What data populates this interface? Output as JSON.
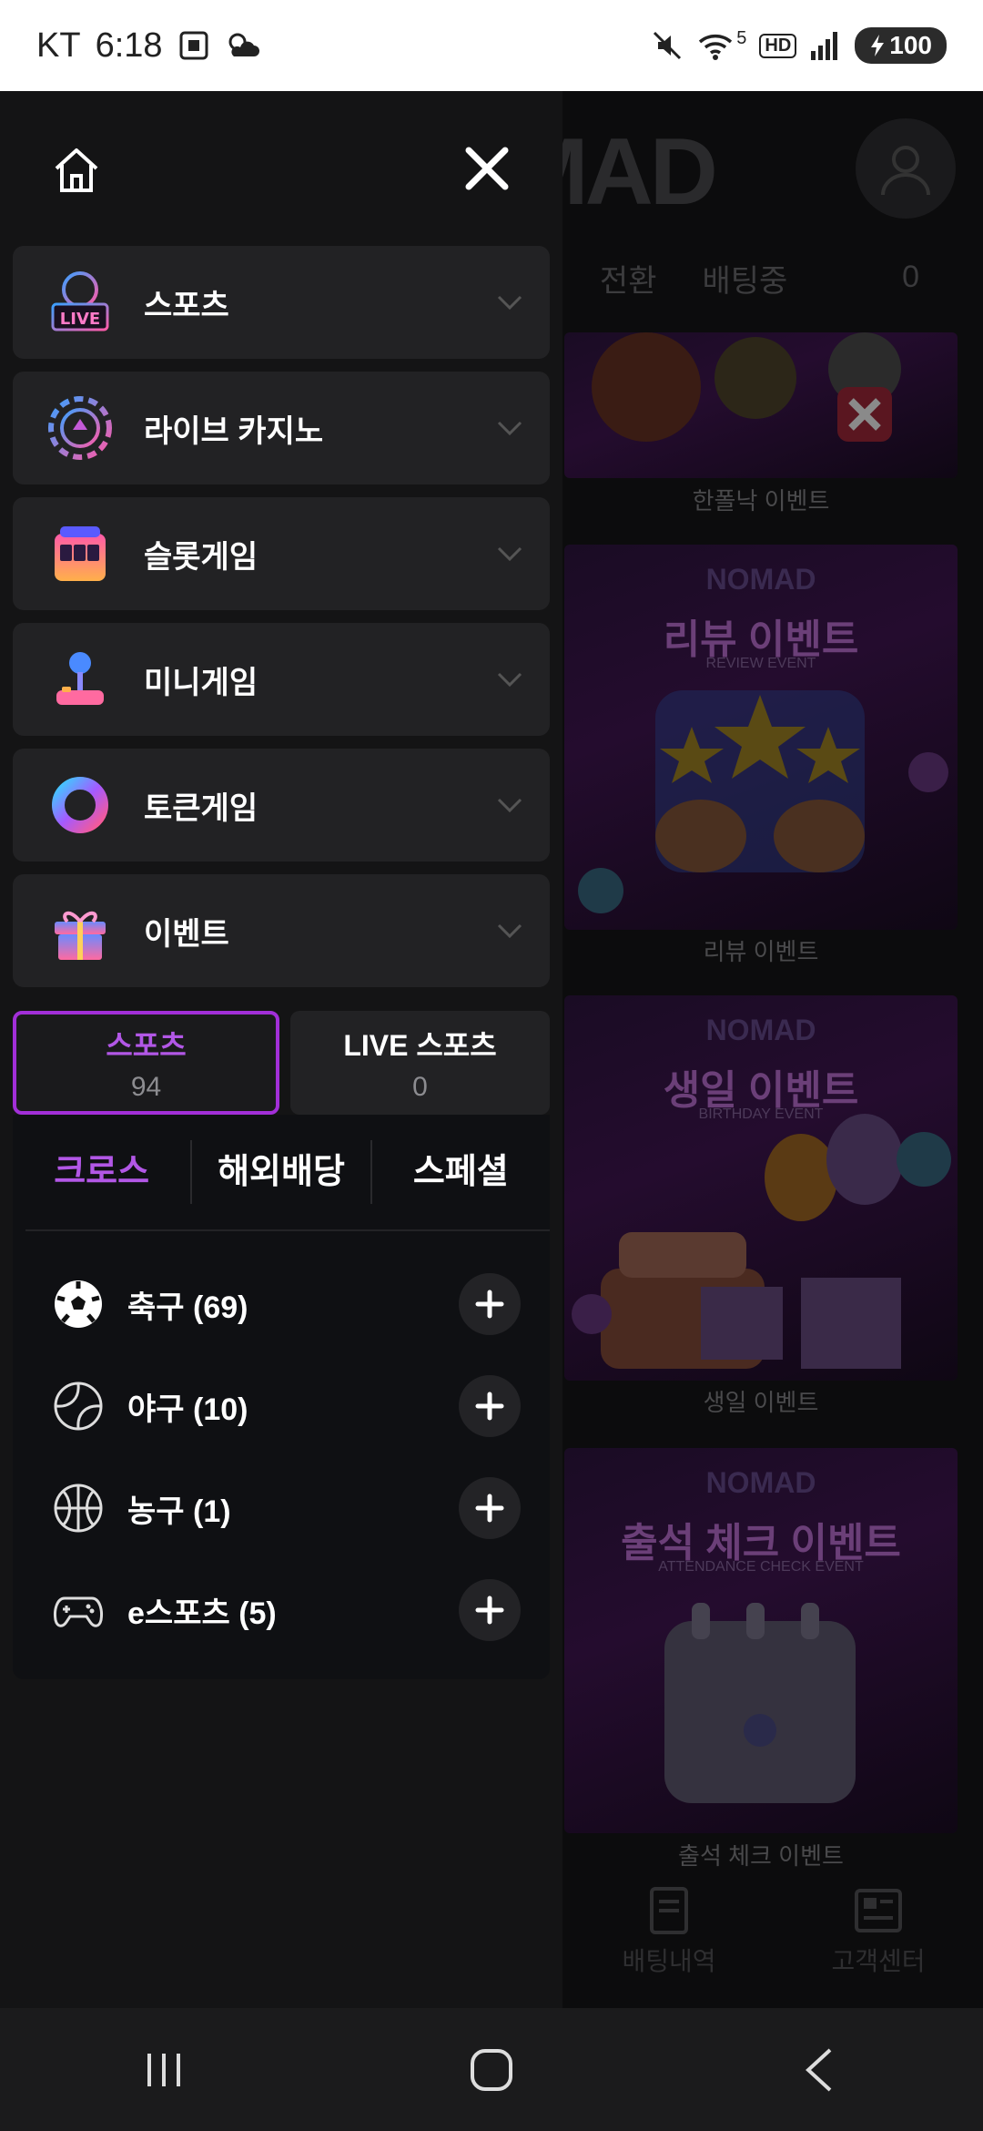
{
  "status_bar": {
    "carrier": "KT",
    "time": "6:18",
    "network_badge": "HD",
    "wifi_sub": "5",
    "battery": "100"
  },
  "background_app": {
    "logo": "MAD",
    "tabs": [
      "0",
      "전환",
      "배팅중"
    ],
    "tab_count": "0",
    "cards": [
      {
        "brand": "",
        "title": "",
        "sub": "",
        "caption": "한폴낙 이벤트"
      },
      {
        "brand": "NOMAD",
        "title": "리뷰 이벤트",
        "sub": "REVIEW EVENT",
        "caption": "리뷰 이벤트"
      },
      {
        "brand": "NOMAD",
        "title": "생일 이벤트",
        "sub": "BIRTHDAY EVENT",
        "caption": "생일 이벤트"
      },
      {
        "brand": "NOMAD",
        "title": "출석 체크 이벤트",
        "sub": "ATTENDANCE CHECK EVENT",
        "caption": "출석 체크 이벤트"
      }
    ],
    "bottom_nav": [
      "배팅내역",
      "고객센터"
    ]
  },
  "drawer": {
    "menu_items": [
      {
        "label": "스포츠",
        "icon": "live-sports-icon"
      },
      {
        "label": "라이브 카지노",
        "icon": "casino-chip-icon"
      },
      {
        "label": "슬롯게임",
        "icon": "slot-machine-icon"
      },
      {
        "label": "미니게임",
        "icon": "joystick-icon"
      },
      {
        "label": "토큰게임",
        "icon": "token-ring-icon"
      },
      {
        "label": "이벤트",
        "icon": "gift-icon"
      }
    ],
    "sport_tabs": [
      {
        "name": "스포츠",
        "count": "94",
        "active": true
      },
      {
        "name": "LIVE 스포츠",
        "count": "0",
        "active": false
      }
    ],
    "sub_tabs": [
      {
        "label": "크로스",
        "active": true
      },
      {
        "label": "해외배당",
        "active": false
      },
      {
        "label": "스페셜",
        "active": false
      }
    ],
    "sports": [
      {
        "label": "축구 (69)",
        "icon": "soccer-ball-icon"
      },
      {
        "label": "야구 (10)",
        "icon": "baseball-icon"
      },
      {
        "label": "농구 (1)",
        "icon": "basketball-icon"
      },
      {
        "label": "e스포츠 (5)",
        "icon": "gamepad-icon"
      }
    ]
  },
  "colors": {
    "accent": "#b257e6",
    "active_border": "#a22fd8",
    "drawer_bg": "#141415",
    "menu_item_bg": "#222224"
  }
}
